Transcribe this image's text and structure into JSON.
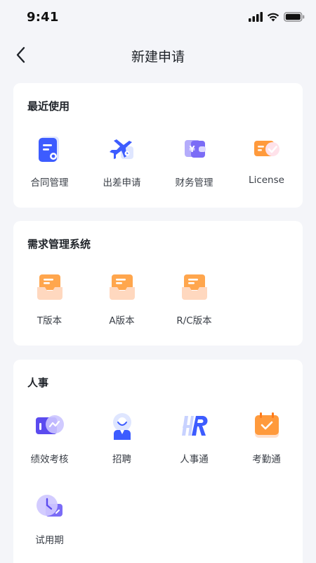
{
  "status": {
    "time": "9:41"
  },
  "nav": {
    "title": "新建申请"
  },
  "recent": {
    "title": "最近使用",
    "items": [
      {
        "label": "合同管理",
        "icon": "contract-icon"
      },
      {
        "label": "出差申请",
        "icon": "flight-icon"
      },
      {
        "label": "财务管理",
        "icon": "wallet-icon"
      },
      {
        "label": "License",
        "icon": "license-icon"
      }
    ]
  },
  "demand": {
    "title": "需求管理系统",
    "items": [
      {
        "label": "T版本",
        "icon": "inbox-icon"
      },
      {
        "label": "A版本",
        "icon": "inbox-icon"
      },
      {
        "label": "R/C版本",
        "icon": "inbox-icon"
      }
    ]
  },
  "hr": {
    "title": "人事",
    "items": [
      {
        "label": "绩效考核",
        "icon": "performance-icon"
      },
      {
        "label": "招聘",
        "icon": "recruit-icon"
      },
      {
        "label": "人事通",
        "icon": "hr-icon"
      },
      {
        "label": "考勤通",
        "icon": "attendance-icon"
      },
      {
        "label": "试用期",
        "icon": "probation-icon"
      }
    ]
  },
  "colors": {
    "accent_blue": "#3d5cff",
    "accent_orange": "#ff9a3c",
    "accent_purple": "#7b6cf6",
    "background": "#f4f5f9"
  }
}
